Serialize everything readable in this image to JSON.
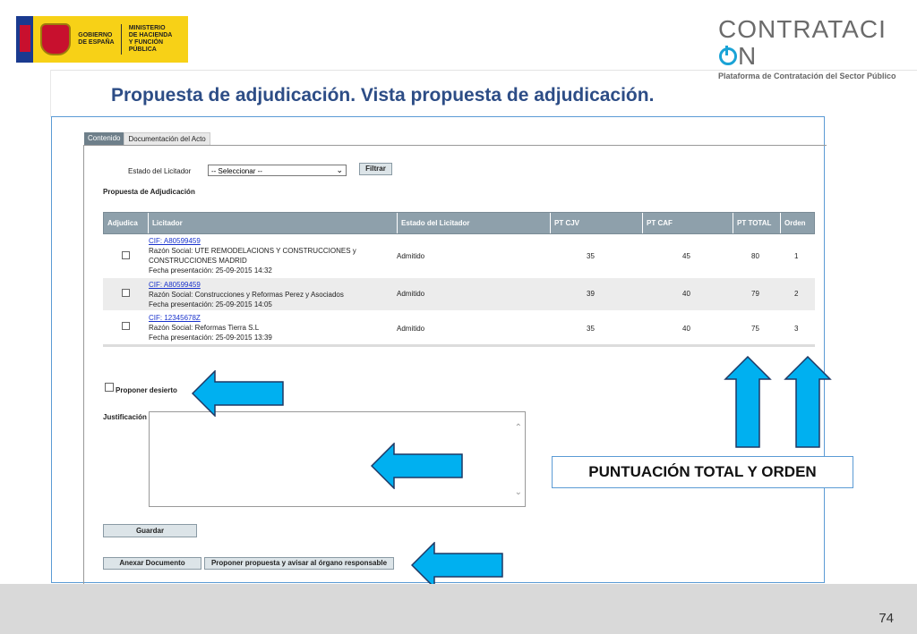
{
  "header": {
    "gov_line1": "GOBIERNO",
    "gov_line2": "DE ESPAÑA",
    "ministry_line1": "MINISTERIO",
    "ministry_line2": "DE HACIENDA",
    "ministry_line3": "Y FUNCIÓN PÚBLICA",
    "brand_pre": "CONTRATACI",
    "brand_post": "N",
    "brand_sub": "Plataforma de Contratación del Sector Público"
  },
  "title": "Propuesta de adjudicación. Vista propuesta de adjudicación.",
  "tabs": [
    {
      "label": "Contenido",
      "active": true
    },
    {
      "label": "Documentación del Acto",
      "active": false
    }
  ],
  "filter": {
    "label": "Estado del Licitador",
    "select_value": "-- Seleccionar --",
    "button": "Filtrar"
  },
  "section_title": "Propuesta de Adjudicación",
  "table": {
    "headers": [
      "Adjudica",
      "Licitador",
      "Estado del Licitador",
      "PT CJV",
      "PT CAF",
      "PT TOTAL",
      "Orden"
    ],
    "rows": [
      {
        "cif": "CIF: A80599459",
        "razon1": "Razón Social: UTE REMODELACIONS Y CONSTRUCCIONES y",
        "razon2": "CONSTRUCCIONES MADRID",
        "fecha": "Fecha presentación: 25-09-2015 14:32",
        "estado": "Admitido",
        "pt_cjv": "35",
        "pt_caf": "45",
        "pt_total": "80",
        "orden": "1"
      },
      {
        "cif": "CIF: A80599459",
        "razon1": "Razón Social: Construcciones y Reformas Perez y Asociados",
        "razon2": "",
        "fecha": "Fecha presentación: 25-09-2015 14:05",
        "estado": "Admitido",
        "pt_cjv": "39",
        "pt_caf": "40",
        "pt_total": "79",
        "orden": "2"
      },
      {
        "cif": "CIF: 12345678Z",
        "razon1": "Razón Social: Reformas Tierra S.L",
        "razon2": "",
        "fecha": "Fecha presentación: 25-09-2015 13:39",
        "estado": "Admitido",
        "pt_cjv": "35",
        "pt_caf": "40",
        "pt_total": "75",
        "orden": "3"
      }
    ]
  },
  "desierto_label": "Proponer desierto",
  "justificacion_label": "Justificación",
  "buttons": {
    "guardar": "Guardar",
    "anexar": "Anexar Documento",
    "proponer": "Proponer propuesta y avisar al órgano responsable"
  },
  "callout": "PUNTUACIÓN TOTAL Y ORDEN",
  "page_number": "74",
  "colors": {
    "arrow_fill": "#00b0f0",
    "title": "#2d4d86",
    "table_header": "#8ea0ab"
  }
}
